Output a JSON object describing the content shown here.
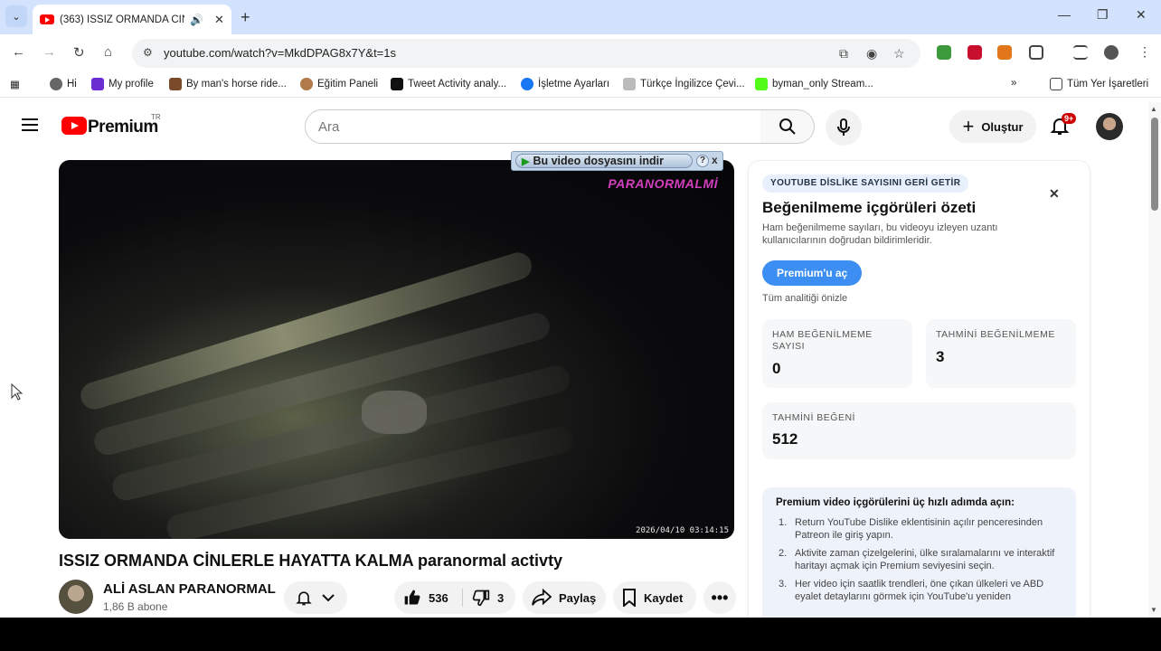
{
  "browser": {
    "tab": {
      "title": "(363) ISSIZ ORMANDA CİNL"
    },
    "url": "youtube.com/watch?v=MkdDPAG8x7Y&t=1s",
    "bookmarks": [
      "Hi",
      "My profile",
      "By man's horse ride...",
      "Eğitim Paneli",
      "Tweet Activity analy...",
      "İşletme Ayarları",
      "Türkçe İngilizce Çevi...",
      "byman_only Stream..."
    ],
    "all_bookmarks": "Tüm Yer İşaretleri"
  },
  "youtube": {
    "brand": "Premium",
    "region": "TR",
    "search_placeholder": "Ara",
    "create_label": "Oluştur",
    "notifications_badge": "9+"
  },
  "player": {
    "download_bar": "Bu video dosyasını indir",
    "download_help": "?",
    "download_close": "x",
    "watermark": "PARANORMALMİ",
    "timestamp": "2026/04/10  03:14:15"
  },
  "video": {
    "title": "ISSIZ ORMANDA CİNLERLE HAYATTA KALMA paranormal activty",
    "channel": "ALİ ASLAN PARANORMAL",
    "subscribers": "1,86 B abone",
    "likes": "536",
    "dislikes": "3",
    "share_label": "Paylaş",
    "save_label": "Kaydet"
  },
  "dislike_panel": {
    "badge": "YOUTUBE DİSLİKE SAYISINI GERİ GETİR",
    "title": "Beğenilmeme içgörüleri özeti",
    "description": "Ham beğenilmeme sayıları, bu videoyu izleyen uzantı kullanıcılarının doğrudan bildirimleridir.",
    "cta": "Premium'u aç",
    "preview": "Tüm analitiği önizle",
    "stats": [
      {
        "label": "HAM BEĞENİLMEME SAYISI",
        "value": "0"
      },
      {
        "label": "TAHMİNİ BEĞENİLMEME",
        "value": "3"
      },
      {
        "label": "TAHMİNİ BEĞENİ",
        "value": "512"
      }
    ],
    "steps_heading": "Premium video içgörülerini üç hızlı adımda açın:",
    "steps": [
      {
        "n": "1.",
        "text": "Return YouTube Dislike eklentisinin açılır penceresinden Patreon ile giriş yapın."
      },
      {
        "n": "2.",
        "text": "Aktivite zaman çizelgelerini, ülke sıralamalarını ve interaktif haritayı açmak için Premium seviyesini seçin."
      },
      {
        "n": "3.",
        "text": "Her video için saatlik trendleri, öne çıkan ülkeleri ve ABD eyalet detaylarını görmek için YouTube'u yeniden"
      }
    ]
  }
}
